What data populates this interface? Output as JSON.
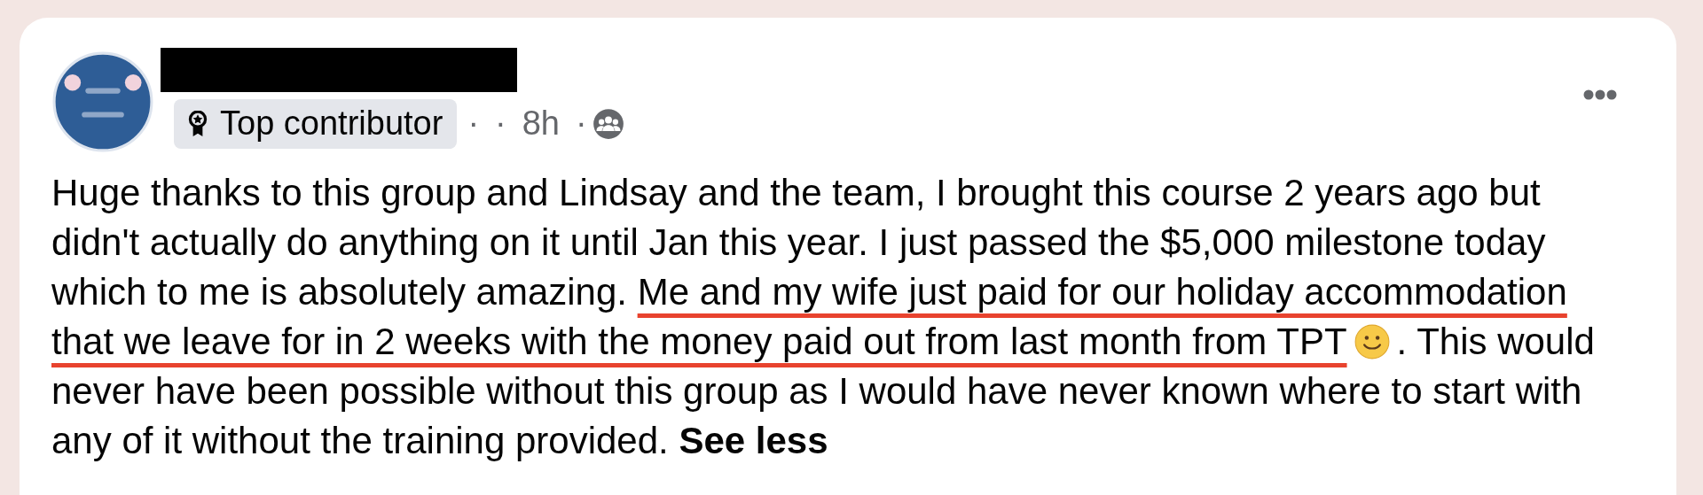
{
  "post": {
    "badge": "Top contributor",
    "meta": [
      "·",
      "·",
      "8h",
      "·"
    ],
    "lines": [
      [
        {
          "kind": "text",
          "text": "Huge thanks to this group and Lindsay and the team, I brought this course 2 years ago but"
        }
      ],
      [
        {
          "kind": "text",
          "text": "didn't actually do anything on it until Jan this year. I just passed the $5,000 milestone today"
        }
      ],
      [
        {
          "kind": "text",
          "text": "which to me is absolutely amazing. "
        },
        {
          "kind": "underlined",
          "text": "Me and my wife just paid for our holiday accommodation"
        }
      ],
      [
        {
          "kind": "underlined",
          "text": "that we leave for in 2 weeks with the money paid out from last month from TPT"
        },
        {
          "kind": "emoji"
        },
        {
          "kind": "text",
          "text": ". This would"
        }
      ],
      [
        {
          "kind": "text",
          "text": "never have been possible without this group as I would have never known where to start with"
        }
      ],
      [
        {
          "kind": "text",
          "text": "any of it without the training provided. "
        },
        {
          "kind": "link",
          "text": "See less"
        }
      ]
    ]
  }
}
